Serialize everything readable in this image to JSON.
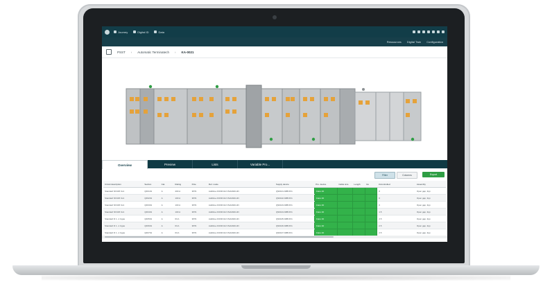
{
  "window": {
    "title": ""
  },
  "topbar": {
    "nav": [
      {
        "label": "Journey",
        "icon": "home-icon"
      },
      {
        "label": "Digital ID",
        "icon": "id-icon"
      },
      {
        "label": "Data",
        "icon": "data-icon"
      }
    ],
    "right_icons": [
      "user-icon",
      "folder-icon",
      "gear-icon",
      "cart-icon",
      "help-icon",
      "info-icon",
      "globe-icon"
    ]
  },
  "subbar": {
    "items": [
      "Ressources",
      "Digital Twin",
      "Configuration"
    ]
  },
  "breadcrumb": {
    "items": [
      "PSST",
      "Automatic Terminatech",
      "KA-0021"
    ]
  },
  "tabs": [
    "Overview",
    "Preview",
    "Lists",
    "Variable Pro..."
  ],
  "toolbar": {
    "btn1": "Filter",
    "btn2": "Columns",
    "btn3": "Export"
  },
  "table": {
    "headers": [
      "Circuit description",
      "Section",
      "Cat.",
      "Rating",
      "Pole",
      "Ref. mode",
      "Supply device",
      "Pro. device",
      "Cable size",
      "Length",
      "Icu",
      "Uncontrolled",
      "Assembly"
    ],
    "rows": [
      [
        "Standard NX40X 3x1",
        "QF0101",
        "A",
        "400 A",
        "3P/N",
        "Additive 2/4NFC1/2 3VA2040-4N",
        "QS0101 ABB 6X1",
        "Ciaru 40",
        "",
        "",
        "",
        "0",
        "Open gap, 3pp"
      ],
      [
        "Standard NX40X 3x1",
        "QF0201",
        "A",
        "100 A",
        "3P/N",
        "Additive 2/4NFC1/2 3VA2040-4N",
        "QS0102 ABB 6X1",
        "Ciaru 40",
        "",
        "",
        "",
        "0",
        "Open gap, 3pp"
      ],
      [
        "Standard NX40X 3x1",
        "QF0301",
        "A",
        "100 A",
        "3P/N",
        "Additive 2/4NFC1/2 3VA2040-4N",
        "QS0103 ABB 6X1",
        "Ciaru 40",
        "",
        "",
        "",
        "0",
        "Open gap, 3pp"
      ],
      [
        "Standard NX40X 3x1",
        "QF0401",
        "A",
        "100 A",
        "3P/N",
        "Additive 2/4NFC1/2 3VA2040-4N",
        "QS0104 ABB 6X1",
        "Ciaru 40",
        "",
        "",
        "",
        "1.5",
        "Open gap, 3pp"
      ],
      [
        "Standard D 1 -1 Ugas",
        "QF0501",
        "A",
        "63 A",
        "3P/N",
        "Additive 2/4NFC1/2 3VA2040-4N",
        "QS0105 ABB 6X1",
        "Ciaru 40",
        "",
        "",
        "",
        "2.5",
        "Open gap, 3pp"
      ],
      [
        "Standard D 1 -1 Ugas",
        "QF0601",
        "A",
        "63 A",
        "3P/N",
        "Additive 2/4NFC1/2 3VA2040-4N",
        "QS0106 ABB 6X1",
        "Ciaru 40",
        "",
        "",
        "",
        "2.5",
        "Open gap, 3pp"
      ],
      [
        "Standard D 1 -1 Ugas",
        "QF0701",
        "A",
        "63 A",
        "3P/N",
        "Additive 2/4NFC1/2 3VA2040-4N",
        "QS0107 ABB 6X1",
        "Ciaru 40",
        "",
        "",
        "",
        "2.5",
        "Open gap, 3pp"
      ]
    ]
  },
  "colors": {
    "topbar": "#123d48",
    "green": "#33b24a",
    "panel": "#bfc2c4",
    "orange": "#e5a23a"
  }
}
